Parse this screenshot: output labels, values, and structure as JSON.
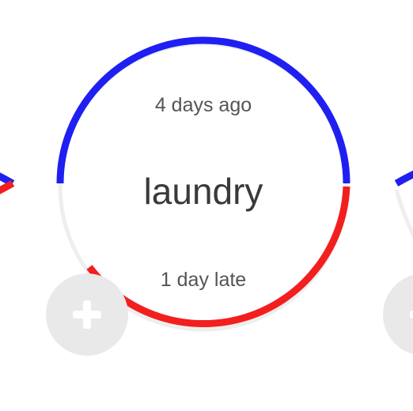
{
  "task": {
    "name": "laundry",
    "last_done": "4 days ago",
    "due_status": "1 day late"
  },
  "colors": {
    "elapsed_arc": "#1f1ff2",
    "overdue_arc": "#f21f1f",
    "track": "#eeeeee",
    "add_button": "#e9e9e9"
  },
  "icons": {
    "add": "plus-icon"
  }
}
